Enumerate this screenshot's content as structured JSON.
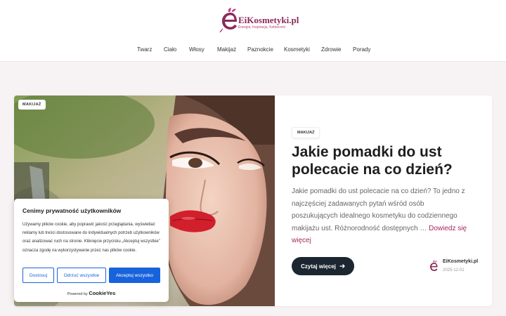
{
  "site": {
    "name": "EiKosmetyki.pl",
    "tagline": "Energia, Inspiracja, Kobiecość",
    "brand_color": "#8b2a5a"
  },
  "nav": {
    "items": [
      "Twarz",
      "Ciało",
      "Włosy",
      "Makijaż",
      "Paznokcie",
      "Kosmetyki",
      "Zdrowie",
      "Porady"
    ]
  },
  "featured": {
    "photo_category": "MAKIJAŻ",
    "category": "MAKIJAŻ",
    "title": "Jakie pomadki do ust polecacie na co dzień?",
    "excerpt": "Jakie pomadki do ust polecacie na co dzień? To jedno z najczęściej zadawanych pytań wśród osób poszukujących idealnego kosmetyku do codziennego makijażu ust. Różnorodność dostępnych … ",
    "read_more_link": "Dowiedz się więcej",
    "button_label": "Czytaj więcej",
    "button_icon": "arrow-right-icon",
    "author": "EiKosmetyki.pl",
    "date": "2025-12-01"
  },
  "cookie": {
    "title": "Cenimy prywatność użytkowników",
    "text": "Używamy plików cookie, aby poprawić jakość przeglądania, wyświetlać reklamy lub treści dostosowane do indywidualnych potrzeb użytkowników oraz analizować ruch na stronie. Kliknięcie przycisku „Akceptuj wszystkie” oznacza zgodę na wykorzystywanie przez nas plików cookie.",
    "customize": "Dostosuj",
    "reject": "Odrzuć wszystkie",
    "accept": "Akceptuj wszystko",
    "powered_by": "Powered by",
    "provider": "CookieYes",
    "accent": "#1863dc"
  }
}
